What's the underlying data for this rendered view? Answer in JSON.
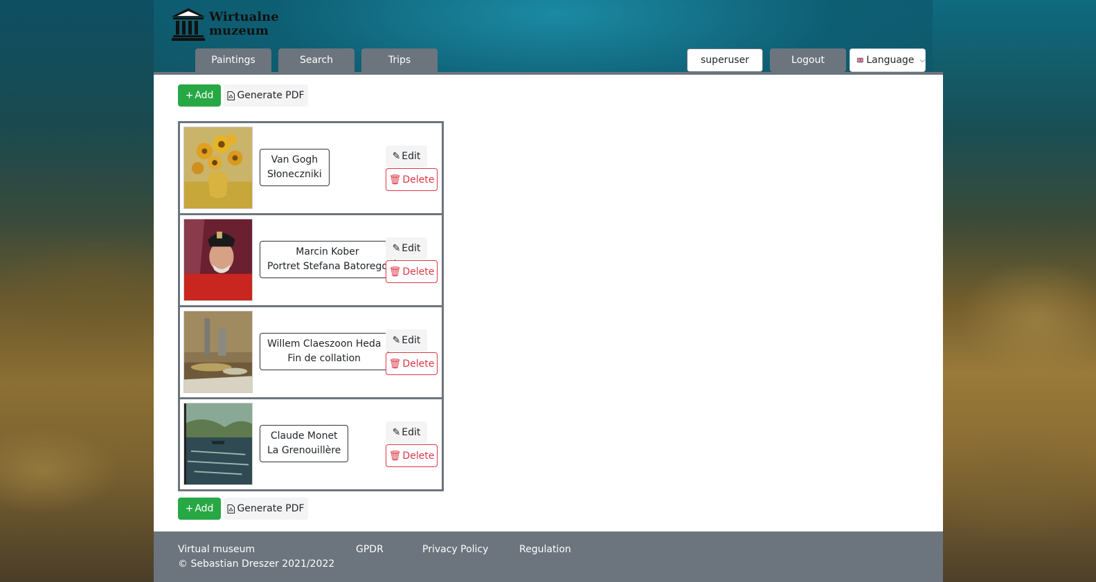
{
  "header": {
    "logo_line1": "Wirtualne",
    "logo_line2": "muzeum",
    "nav": [
      "Paintings",
      "Search",
      "Trips"
    ],
    "username": "superuser",
    "logout_label": "Logout",
    "language_label": "Language"
  },
  "toolbar": {
    "add_label": "Add",
    "pdf_label": "Generate PDF"
  },
  "paintings": [
    {
      "artist": "Van Gogh",
      "title": "Słoneczniki",
      "edit_label": "Edit",
      "delete_label": "Delete"
    },
    {
      "artist": "Marcin Kober",
      "title": "Portret Stefana Batorego",
      "edit_label": "Edit",
      "delete_label": "Delete"
    },
    {
      "artist": "Willem Claeszoon Heda",
      "title": "Fin de collation",
      "edit_label": "Edit",
      "delete_label": "Delete"
    },
    {
      "artist": "Claude Monet",
      "title": "La Grenouillère",
      "edit_label": "Edit",
      "delete_label": "Delete"
    }
  ],
  "footer": {
    "site_name": "Virtual museum",
    "copyright": "© Sebastian Dreszer 2021/2022",
    "links": [
      "GPDR",
      "Privacy Policy",
      "Regulation"
    ]
  },
  "colors": {
    "nav_gray": "#6c757d",
    "add_green": "#28a745",
    "delete_red": "#dc3545"
  }
}
